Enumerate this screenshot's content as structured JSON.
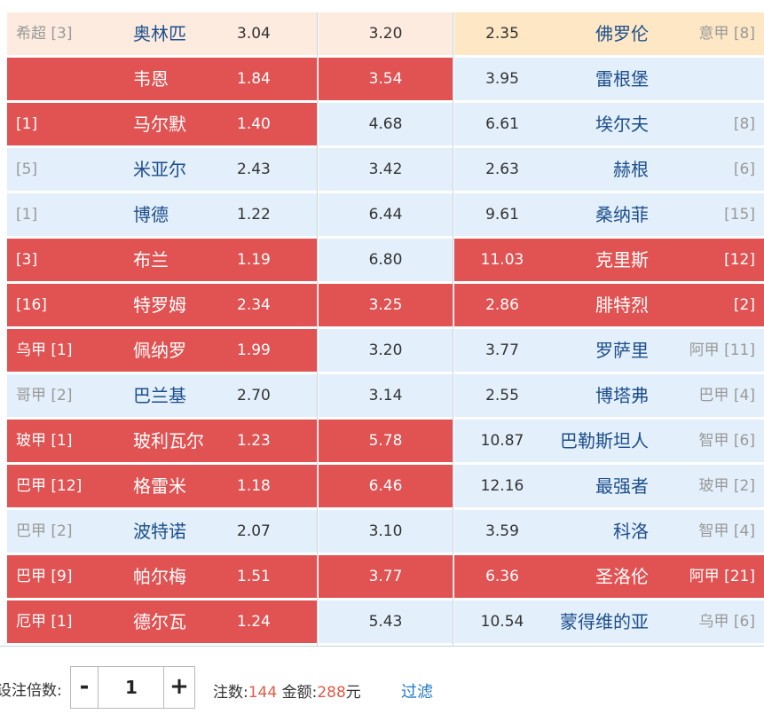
{
  "matches": [
    {
      "home_league": "希超 [3]",
      "home_team": "奥林匹",
      "home_odds": "3.04",
      "draw_odds": "3.20",
      "away_odds": "2.35",
      "away_team": "佛罗伦",
      "away_league": "意甲 [8]",
      "home_sel": "peach",
      "draw_sel": "peach",
      "away_sel": "gold"
    },
    {
      "home_league": "",
      "home_team": "韦恩",
      "home_odds": "1.84",
      "draw_odds": "3.54",
      "away_odds": "3.95",
      "away_team": "雷根堡",
      "away_league": "",
      "home_sel": "selected",
      "draw_sel": "selected",
      "away_sel": "default"
    },
    {
      "home_league": "[1]",
      "home_team": "马尔默",
      "home_odds": "1.40",
      "draw_odds": "4.68",
      "away_odds": "6.61",
      "away_team": "埃尔夫",
      "away_league": "[8]",
      "home_sel": "selected",
      "draw_sel": "default",
      "away_sel": "default"
    },
    {
      "home_league": "[5]",
      "home_team": "米亚尔",
      "home_odds": "2.43",
      "draw_odds": "3.42",
      "away_odds": "2.63",
      "away_team": "赫根",
      "away_league": "[6]",
      "home_sel": "default",
      "draw_sel": "default",
      "away_sel": "default"
    },
    {
      "home_league": "[1]",
      "home_team": "博德",
      "home_odds": "1.22",
      "draw_odds": "6.44",
      "away_odds": "9.61",
      "away_team": "桑纳菲",
      "away_league": "[15]",
      "home_sel": "default",
      "draw_sel": "default",
      "away_sel": "default"
    },
    {
      "home_league": "[3]",
      "home_team": "布兰",
      "home_odds": "1.19",
      "draw_odds": "6.80",
      "away_odds": "11.03",
      "away_team": "克里斯",
      "away_league": "[12]",
      "home_sel": "selected",
      "draw_sel": "default",
      "away_sel": "selected"
    },
    {
      "home_league": "[16]",
      "home_team": "特罗姆",
      "home_odds": "2.34",
      "draw_odds": "3.25",
      "away_odds": "2.86",
      "away_team": "腓特烈",
      "away_league": "[2]",
      "home_sel": "selected",
      "draw_sel": "selected",
      "away_sel": "selected"
    },
    {
      "home_league": "乌甲 [1]",
      "home_team": "佩纳罗",
      "home_odds": "1.99",
      "draw_odds": "3.20",
      "away_odds": "3.77",
      "away_team": "罗萨里",
      "away_league": "阿甲 [11]",
      "home_sel": "selected",
      "draw_sel": "default",
      "away_sel": "default"
    },
    {
      "home_league": "哥甲 [2]",
      "home_team": "巴兰基",
      "home_odds": "2.70",
      "draw_odds": "3.14",
      "away_odds": "2.55",
      "away_team": "博塔弗",
      "away_league": "巴甲 [4]",
      "home_sel": "default",
      "draw_sel": "default",
      "away_sel": "default"
    },
    {
      "home_league": "玻甲 [1]",
      "home_team": "玻利瓦尔",
      "home_odds": "1.23",
      "draw_odds": "5.78",
      "away_odds": "10.87",
      "away_team": "巴勒斯坦人",
      "away_league": "智甲 [6]",
      "home_sel": "selected",
      "draw_sel": "selected",
      "away_sel": "default"
    },
    {
      "home_league": "巴甲 [12]",
      "home_team": "格雷米",
      "home_odds": "1.18",
      "draw_odds": "6.46",
      "away_odds": "12.16",
      "away_team": "最强者",
      "away_league": "玻甲 [2]",
      "home_sel": "selected",
      "draw_sel": "selected",
      "away_sel": "default"
    },
    {
      "home_league": "巴甲 [2]",
      "home_team": "波特诺",
      "home_odds": "2.07",
      "draw_odds": "3.10",
      "away_odds": "3.59",
      "away_team": "科洛",
      "away_league": "智甲 [4]",
      "home_sel": "default",
      "draw_sel": "default",
      "away_sel": "default"
    },
    {
      "home_league": "巴甲 [9]",
      "home_team": "帕尔梅",
      "home_odds": "1.51",
      "draw_odds": "3.77",
      "away_odds": "6.36",
      "away_team": "圣洛伦",
      "away_league": "阿甲 [21]",
      "home_sel": "selected",
      "draw_sel": "selected",
      "away_sel": "selected"
    },
    {
      "home_league": "厄甲 [1]",
      "home_team": "德尔瓦",
      "home_odds": "1.24",
      "draw_odds": "5.43",
      "away_odds": "10.54",
      "away_team": "蒙得维的亚",
      "away_league": "乌甲 [6]",
      "home_sel": "selected",
      "draw_sel": "default",
      "away_sel": "default"
    }
  ],
  "footer": {
    "multiplier_label": "设注倍数:",
    "minus": "-",
    "plus": "+",
    "multiplier_value": "1",
    "bets_label": "注数:",
    "bets_value": "144",
    "amount_label": " 金额:",
    "amount_value": "288",
    "currency": "元",
    "filter_label": "过滤"
  },
  "colors": {
    "selected": "#e15252",
    "default": "#e3effa",
    "peach": "#fdebdf",
    "gold": "#fde7c4",
    "team_text": "#1d4f8c",
    "highlight_number": "#e05a47"
  }
}
